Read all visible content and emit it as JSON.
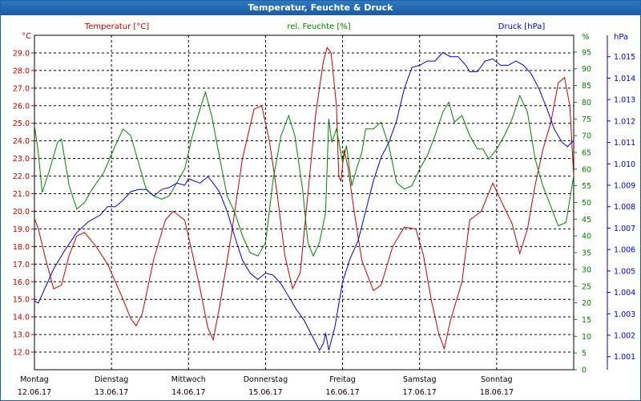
{
  "window": {
    "title": "Temperatur, Feuchte & Druck"
  },
  "chart_data": {
    "type": "line",
    "axes": {
      "temperature": {
        "unit_label": "°C",
        "title": "Temperatur [°C]",
        "color": "#c00000",
        "range": [
          11.0,
          30.0
        ],
        "ticks": [
          "12.0",
          "13.0",
          "14.0",
          "15.0",
          "16.0",
          "17.0",
          "18.0",
          "19.0",
          "20.0",
          "21.0",
          "22.0",
          "23.0",
          "24.0",
          "25.0",
          "26.0",
          "27.0",
          "28.0",
          "29.0"
        ]
      },
      "humidity": {
        "unit_label": "%",
        "title": "rel. Feuchte [%]",
        "color": "#008000",
        "range": [
          0,
          100
        ],
        "ticks": [
          "0",
          "5",
          "10",
          "15",
          "20",
          "25",
          "30",
          "35",
          "40",
          "45",
          "50",
          "55",
          "60",
          "65",
          "70",
          "75",
          "80",
          "85",
          "90",
          "95"
        ]
      },
      "pressure": {
        "unit_label": "hPa",
        "title": "Druck [hPa]",
        "color": "#0000c0",
        "range": [
          1000.39,
          1016.0
        ],
        "ticks": [
          "1.001",
          "1.002",
          "1.003",
          "1.004",
          "1.005",
          "1.006",
          "1.007",
          "1.008",
          "1.009",
          "1.010",
          "1.011",
          "1.012",
          "1.013",
          "1.014",
          "1.015"
        ]
      }
    },
    "x": {
      "range_days": [
        0,
        7
      ],
      "days": [
        {
          "name": "Montag",
          "date": "12.06.17"
        },
        {
          "name": "Dienstag",
          "date": "13.06.17"
        },
        {
          "name": "Mittwoch",
          "date": "14.06.17"
        },
        {
          "name": "Donnerstag",
          "date": "15.06.17"
        },
        {
          "name": "Freitag",
          "date": "16.06.17"
        },
        {
          "name": "Samstag",
          "date": "17.06.17"
        },
        {
          "name": "Sonntag",
          "date": "18.06.17"
        }
      ]
    },
    "grid": true,
    "series": [
      {
        "name": "Temperatur [°C]",
        "axis": "temperature",
        "color": "#c00000",
        "points": [
          [
            0.0,
            19.6
          ],
          [
            0.05,
            19.0
          ],
          [
            0.15,
            17.2
          ],
          [
            0.25,
            15.6
          ],
          [
            0.35,
            15.8
          ],
          [
            0.45,
            17.5
          ],
          [
            0.55,
            18.6
          ],
          [
            0.65,
            18.8
          ],
          [
            0.8,
            18.0
          ],
          [
            0.95,
            17.0
          ],
          [
            1.05,
            16.0
          ],
          [
            1.15,
            15.0
          ],
          [
            1.25,
            13.9
          ],
          [
            1.32,
            13.5
          ],
          [
            1.4,
            14.2
          ],
          [
            1.55,
            17.3
          ],
          [
            1.7,
            19.5
          ],
          [
            1.8,
            20.0
          ],
          [
            1.95,
            19.5
          ],
          [
            2.05,
            17.6
          ],
          [
            2.15,
            15.6
          ],
          [
            2.25,
            13.4
          ],
          [
            2.32,
            12.7
          ],
          [
            2.4,
            14.5
          ],
          [
            2.55,
            18.5
          ],
          [
            2.7,
            23.0
          ],
          [
            2.85,
            25.8
          ],
          [
            2.95,
            26.0
          ],
          [
            3.05,
            24.0
          ],
          [
            3.15,
            21.0
          ],
          [
            3.25,
            17.5
          ],
          [
            3.35,
            15.6
          ],
          [
            3.45,
            16.5
          ],
          [
            3.55,
            21.0
          ],
          [
            3.65,
            25.5
          ],
          [
            3.75,
            28.5
          ],
          [
            3.8,
            29.3
          ],
          [
            3.85,
            29.0
          ],
          [
            3.92,
            26.0
          ],
          [
            3.95,
            22.0
          ],
          [
            3.98,
            21.7
          ],
          [
            4.02,
            23.5
          ],
          [
            4.07,
            22.5
          ],
          [
            4.15,
            20.0
          ],
          [
            4.25,
            17.2
          ],
          [
            4.4,
            15.5
          ],
          [
            4.5,
            15.8
          ],
          [
            4.65,
            18.0
          ],
          [
            4.8,
            19.1
          ],
          [
            4.95,
            19.0
          ],
          [
            5.05,
            17.5
          ],
          [
            5.15,
            15.0
          ],
          [
            5.25,
            13.0
          ],
          [
            5.32,
            12.2
          ],
          [
            5.4,
            13.8
          ],
          [
            5.55,
            16.0
          ],
          [
            5.65,
            19.5
          ],
          [
            5.8,
            20.0
          ],
          [
            5.95,
            21.6
          ],
          [
            6.1,
            20.2
          ],
          [
            6.2,
            19.3
          ],
          [
            6.3,
            17.6
          ],
          [
            6.4,
            19.0
          ],
          [
            6.5,
            21.5
          ],
          [
            6.6,
            23.5
          ],
          [
            6.7,
            25.0
          ],
          [
            6.8,
            27.3
          ],
          [
            6.88,
            27.6
          ],
          [
            6.95,
            26.0
          ],
          [
            7.0,
            22.0
          ]
        ]
      },
      {
        "name": "rel. Feuchte [%]",
        "axis": "humidity",
        "color": "#008000",
        "points": [
          [
            0.0,
            73
          ],
          [
            0.05,
            65
          ],
          [
            0.1,
            53
          ],
          [
            0.2,
            60
          ],
          [
            0.3,
            68
          ],
          [
            0.35,
            69
          ],
          [
            0.45,
            55
          ],
          [
            0.55,
            48
          ],
          [
            0.65,
            50
          ],
          [
            0.75,
            54
          ],
          [
            0.9,
            59
          ],
          [
            1.05,
            67
          ],
          [
            1.15,
            72
          ],
          [
            1.25,
            70
          ],
          [
            1.35,
            62
          ],
          [
            1.45,
            54
          ],
          [
            1.55,
            52
          ],
          [
            1.65,
            51
          ],
          [
            1.75,
            52
          ],
          [
            1.85,
            56
          ],
          [
            1.95,
            60
          ],
          [
            2.05,
            70
          ],
          [
            2.15,
            78
          ],
          [
            2.22,
            83
          ],
          [
            2.3,
            76
          ],
          [
            2.4,
            64
          ],
          [
            2.5,
            52
          ],
          [
            2.6,
            47
          ],
          [
            2.7,
            40
          ],
          [
            2.8,
            35
          ],
          [
            2.9,
            34
          ],
          [
            3.0,
            38
          ],
          [
            3.1,
            57
          ],
          [
            3.2,
            70
          ],
          [
            3.3,
            76
          ],
          [
            3.38,
            70
          ],
          [
            3.48,
            54
          ],
          [
            3.55,
            38
          ],
          [
            3.62,
            34
          ],
          [
            3.7,
            38
          ],
          [
            3.78,
            47
          ],
          [
            3.82,
            75
          ],
          [
            3.86,
            68
          ],
          [
            3.92,
            72
          ],
          [
            4.0,
            62
          ],
          [
            4.05,
            67
          ],
          [
            4.12,
            55
          ],
          [
            4.18,
            60
          ],
          [
            4.25,
            65
          ],
          [
            4.3,
            72
          ],
          [
            4.4,
            72
          ],
          [
            4.5,
            74
          ],
          [
            4.6,
            67
          ],
          [
            4.7,
            56
          ],
          [
            4.8,
            54
          ],
          [
            4.9,
            55
          ],
          [
            5.0,
            60
          ],
          [
            5.1,
            64
          ],
          [
            5.2,
            70
          ],
          [
            5.3,
            77
          ],
          [
            5.38,
            80
          ],
          [
            5.45,
            74
          ],
          [
            5.55,
            76
          ],
          [
            5.65,
            70
          ],
          [
            5.75,
            66
          ],
          [
            5.82,
            66
          ],
          [
            5.9,
            63
          ],
          [
            6.0,
            66
          ],
          [
            6.1,
            70
          ],
          [
            6.2,
            75
          ],
          [
            6.3,
            82
          ],
          [
            6.4,
            77
          ],
          [
            6.5,
            63
          ],
          [
            6.6,
            55
          ],
          [
            6.7,
            49
          ],
          [
            6.8,
            43
          ],
          [
            6.9,
            44
          ],
          [
            7.0,
            58
          ]
        ]
      },
      {
        "name": "Druck [hPa]",
        "axis": "pressure",
        "color": "#0000c0",
        "points": [
          [
            0.0,
            1003.6
          ],
          [
            0.05,
            1003.5
          ],
          [
            0.15,
            1004.3
          ],
          [
            0.25,
            1005.1
          ],
          [
            0.4,
            1006.0
          ],
          [
            0.55,
            1006.8
          ],
          [
            0.7,
            1007.3
          ],
          [
            0.85,
            1007.6
          ],
          [
            0.95,
            1008.0
          ],
          [
            1.05,
            1008.0
          ],
          [
            1.15,
            1008.3
          ],
          [
            1.25,
            1008.7
          ],
          [
            1.35,
            1008.8
          ],
          [
            1.45,
            1008.8
          ],
          [
            1.55,
            1008.5
          ],
          [
            1.65,
            1008.8
          ],
          [
            1.75,
            1008.9
          ],
          [
            1.85,
            1009.1
          ],
          [
            1.95,
            1009.0
          ],
          [
            2.0,
            1009.3
          ],
          [
            2.15,
            1009.1
          ],
          [
            2.25,
            1009.4
          ],
          [
            2.3,
            1009.2
          ],
          [
            2.4,
            1008.7
          ],
          [
            2.5,
            1007.8
          ],
          [
            2.6,
            1006.6
          ],
          [
            2.7,
            1005.5
          ],
          [
            2.8,
            1004.9
          ],
          [
            2.9,
            1004.6
          ],
          [
            3.0,
            1004.9
          ],
          [
            3.1,
            1004.8
          ],
          [
            3.2,
            1004.4
          ],
          [
            3.3,
            1003.8
          ],
          [
            3.4,
            1003.2
          ],
          [
            3.5,
            1002.7
          ],
          [
            3.6,
            1002.0
          ],
          [
            3.7,
            1001.3
          ],
          [
            3.75,
            1001.6
          ],
          [
            3.78,
            1002.1
          ],
          [
            3.82,
            1001.3
          ],
          [
            3.9,
            1002.4
          ],
          [
            4.0,
            1004.5
          ],
          [
            4.1,
            1005.6
          ],
          [
            4.2,
            1006.4
          ],
          [
            4.3,
            1007.8
          ],
          [
            4.4,
            1009.2
          ],
          [
            4.5,
            1010.3
          ],
          [
            4.6,
            1011.0
          ],
          [
            4.7,
            1012.0
          ],
          [
            4.8,
            1013.5
          ],
          [
            4.9,
            1014.5
          ],
          [
            5.0,
            1014.6
          ],
          [
            5.1,
            1014.8
          ],
          [
            5.2,
            1014.8
          ],
          [
            5.3,
            1015.2
          ],
          [
            5.4,
            1015.0
          ],
          [
            5.5,
            1015.0
          ],
          [
            5.6,
            1014.6
          ],
          [
            5.65,
            1014.3
          ],
          [
            5.75,
            1014.3
          ],
          [
            5.85,
            1014.8
          ],
          [
            5.95,
            1014.9
          ],
          [
            6.05,
            1014.6
          ],
          [
            6.15,
            1014.6
          ],
          [
            6.25,
            1014.8
          ],
          [
            6.35,
            1014.6
          ],
          [
            6.45,
            1014.2
          ],
          [
            6.55,
            1013.5
          ],
          [
            6.65,
            1012.6
          ],
          [
            6.75,
            1011.6
          ],
          [
            6.85,
            1011.0
          ],
          [
            6.92,
            1010.8
          ],
          [
            7.0,
            1011.1
          ]
        ]
      }
    ]
  }
}
